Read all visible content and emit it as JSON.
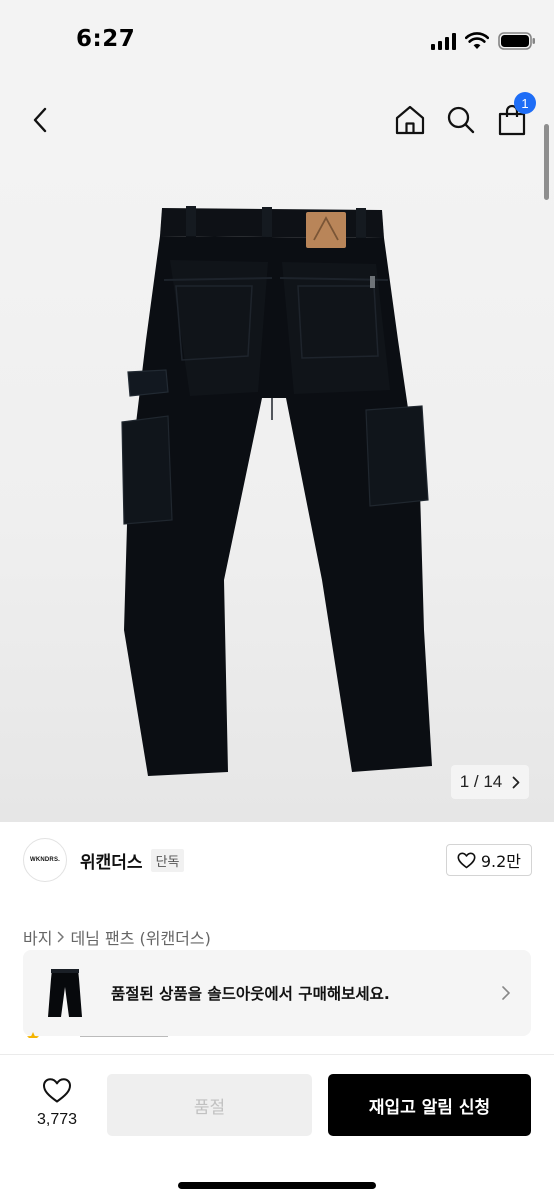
{
  "status_bar": {
    "time": "6:27"
  },
  "nav": {
    "cart_count": "1"
  },
  "gallery": {
    "pager": "1 / 14"
  },
  "brand": {
    "logo_text": "WKNDRS.",
    "name": "위캔더스",
    "tag": "단독",
    "likes": "9.2만"
  },
  "breadcrumb": {
    "category": "바지",
    "subcategory": "데님 팬츠 (위캔더스)"
  },
  "soldout_banner": {
    "text": "품절된 상품을 솔드아웃에서 구매해보세요."
  },
  "bottom": {
    "wish_count": "3,773",
    "soldout_label": "품절",
    "restock_label": "재입고 알림 신청"
  },
  "colors": {
    "badge": "#1e6df6",
    "primary_button": "#000000",
    "disabled_button": "#efefef"
  }
}
